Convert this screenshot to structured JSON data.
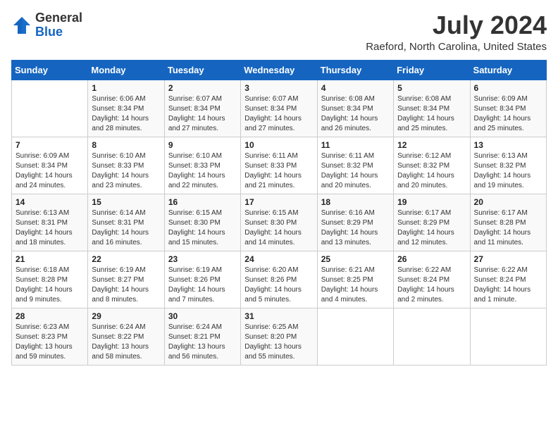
{
  "header": {
    "logo_general": "General",
    "logo_blue": "Blue",
    "month_year": "July 2024",
    "location": "Raeford, North Carolina, United States"
  },
  "calendar": {
    "days_of_week": [
      "Sunday",
      "Monday",
      "Tuesday",
      "Wednesday",
      "Thursday",
      "Friday",
      "Saturday"
    ],
    "weeks": [
      [
        {
          "day": "",
          "detail": ""
        },
        {
          "day": "1",
          "detail": "Sunrise: 6:06 AM\nSunset: 8:34 PM\nDaylight: 14 hours\nand 28 minutes."
        },
        {
          "day": "2",
          "detail": "Sunrise: 6:07 AM\nSunset: 8:34 PM\nDaylight: 14 hours\nand 27 minutes."
        },
        {
          "day": "3",
          "detail": "Sunrise: 6:07 AM\nSunset: 8:34 PM\nDaylight: 14 hours\nand 27 minutes."
        },
        {
          "day": "4",
          "detail": "Sunrise: 6:08 AM\nSunset: 8:34 PM\nDaylight: 14 hours\nand 26 minutes."
        },
        {
          "day": "5",
          "detail": "Sunrise: 6:08 AM\nSunset: 8:34 PM\nDaylight: 14 hours\nand 25 minutes."
        },
        {
          "day": "6",
          "detail": "Sunrise: 6:09 AM\nSunset: 8:34 PM\nDaylight: 14 hours\nand 25 minutes."
        }
      ],
      [
        {
          "day": "7",
          "detail": "Sunrise: 6:09 AM\nSunset: 8:34 PM\nDaylight: 14 hours\nand 24 minutes."
        },
        {
          "day": "8",
          "detail": "Sunrise: 6:10 AM\nSunset: 8:33 PM\nDaylight: 14 hours\nand 23 minutes."
        },
        {
          "day": "9",
          "detail": "Sunrise: 6:10 AM\nSunset: 8:33 PM\nDaylight: 14 hours\nand 22 minutes."
        },
        {
          "day": "10",
          "detail": "Sunrise: 6:11 AM\nSunset: 8:33 PM\nDaylight: 14 hours\nand 21 minutes."
        },
        {
          "day": "11",
          "detail": "Sunrise: 6:11 AM\nSunset: 8:32 PM\nDaylight: 14 hours\nand 20 minutes."
        },
        {
          "day": "12",
          "detail": "Sunrise: 6:12 AM\nSunset: 8:32 PM\nDaylight: 14 hours\nand 20 minutes."
        },
        {
          "day": "13",
          "detail": "Sunrise: 6:13 AM\nSunset: 8:32 PM\nDaylight: 14 hours\nand 19 minutes."
        }
      ],
      [
        {
          "day": "14",
          "detail": "Sunrise: 6:13 AM\nSunset: 8:31 PM\nDaylight: 14 hours\nand 18 minutes."
        },
        {
          "day": "15",
          "detail": "Sunrise: 6:14 AM\nSunset: 8:31 PM\nDaylight: 14 hours\nand 16 minutes."
        },
        {
          "day": "16",
          "detail": "Sunrise: 6:15 AM\nSunset: 8:30 PM\nDaylight: 14 hours\nand 15 minutes."
        },
        {
          "day": "17",
          "detail": "Sunrise: 6:15 AM\nSunset: 8:30 PM\nDaylight: 14 hours\nand 14 minutes."
        },
        {
          "day": "18",
          "detail": "Sunrise: 6:16 AM\nSunset: 8:29 PM\nDaylight: 14 hours\nand 13 minutes."
        },
        {
          "day": "19",
          "detail": "Sunrise: 6:17 AM\nSunset: 8:29 PM\nDaylight: 14 hours\nand 12 minutes."
        },
        {
          "day": "20",
          "detail": "Sunrise: 6:17 AM\nSunset: 8:28 PM\nDaylight: 14 hours\nand 11 minutes."
        }
      ],
      [
        {
          "day": "21",
          "detail": "Sunrise: 6:18 AM\nSunset: 8:28 PM\nDaylight: 14 hours\nand 9 minutes."
        },
        {
          "day": "22",
          "detail": "Sunrise: 6:19 AM\nSunset: 8:27 PM\nDaylight: 14 hours\nand 8 minutes."
        },
        {
          "day": "23",
          "detail": "Sunrise: 6:19 AM\nSunset: 8:26 PM\nDaylight: 14 hours\nand 7 minutes."
        },
        {
          "day": "24",
          "detail": "Sunrise: 6:20 AM\nSunset: 8:26 PM\nDaylight: 14 hours\nand 5 minutes."
        },
        {
          "day": "25",
          "detail": "Sunrise: 6:21 AM\nSunset: 8:25 PM\nDaylight: 14 hours\nand 4 minutes."
        },
        {
          "day": "26",
          "detail": "Sunrise: 6:22 AM\nSunset: 8:24 PM\nDaylight: 14 hours\nand 2 minutes."
        },
        {
          "day": "27",
          "detail": "Sunrise: 6:22 AM\nSunset: 8:24 PM\nDaylight: 14 hours\nand 1 minute."
        }
      ],
      [
        {
          "day": "28",
          "detail": "Sunrise: 6:23 AM\nSunset: 8:23 PM\nDaylight: 13 hours\nand 59 minutes."
        },
        {
          "day": "29",
          "detail": "Sunrise: 6:24 AM\nSunset: 8:22 PM\nDaylight: 13 hours\nand 58 minutes."
        },
        {
          "day": "30",
          "detail": "Sunrise: 6:24 AM\nSunset: 8:21 PM\nDaylight: 13 hours\nand 56 minutes."
        },
        {
          "day": "31",
          "detail": "Sunrise: 6:25 AM\nSunset: 8:20 PM\nDaylight: 13 hours\nand 55 minutes."
        },
        {
          "day": "",
          "detail": ""
        },
        {
          "day": "",
          "detail": ""
        },
        {
          "day": "",
          "detail": ""
        }
      ]
    ]
  }
}
